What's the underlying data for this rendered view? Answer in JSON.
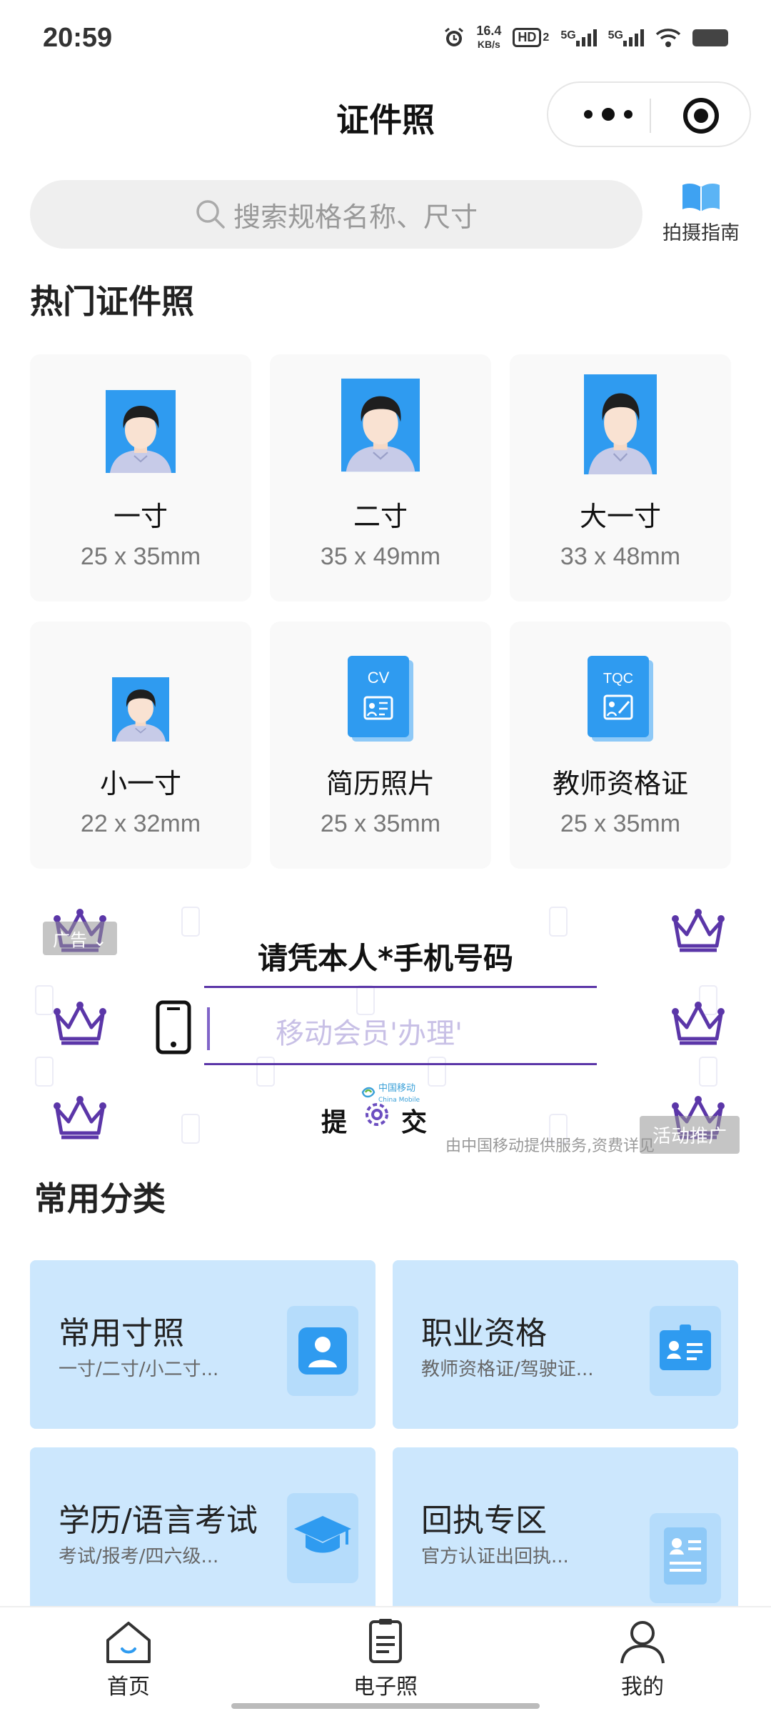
{
  "status_bar": {
    "time": "20:59",
    "speed_value": "16.4",
    "speed_unit": "KB/s",
    "hd_label": "HD",
    "hd_sub": "2",
    "net1": "5G",
    "net2": "5G",
    "icons": [
      "alarm-icon",
      "hd-icon",
      "signal-icon",
      "signal-icon",
      "wifi-icon",
      "battery-icon"
    ]
  },
  "navbar": {
    "title": "证件照"
  },
  "search": {
    "placeholder": "搜索规格名称、尺寸"
  },
  "guide": {
    "label": "拍摄指南"
  },
  "hot": {
    "title": "热门证件照",
    "cards": [
      {
        "name": "一寸",
        "size": "25 x 35mm"
      },
      {
        "name": "二寸",
        "size": "35 x 49mm"
      },
      {
        "name": "大一寸",
        "size": "33 x 48mm"
      },
      {
        "name": "小一寸",
        "size": "22 x 32mm"
      },
      {
        "name": "简历照片",
        "size": "25 x 35mm",
        "icon_text": "CV"
      },
      {
        "name": "教师资格证",
        "size": "25 x 35mm",
        "icon_text": "TQC"
      }
    ]
  },
  "ad": {
    "tag": "广告",
    "headline": "请凭本人*手机号码",
    "input_placeholder": "移动会员'办理'",
    "submit_left": "提",
    "submit_right": "交",
    "brand": "中国移动",
    "brand_en": "China Mobile",
    "note": "由中国移动提供服务,资费详见",
    "promo": "活动推广"
  },
  "categories": {
    "title": "常用分类",
    "items": [
      {
        "title": "常用寸照",
        "desc": "一寸/二寸/小二寸..."
      },
      {
        "title": "职业资格",
        "desc": "教师资格证/驾驶证..."
      },
      {
        "title": "学历/语言考试",
        "desc": "考试/报考/四六级..."
      },
      {
        "title": "回执专区",
        "desc": "官方认证出回执..."
      }
    ]
  },
  "tabbar": {
    "items": [
      {
        "label": "首页",
        "icon": "home-icon",
        "active": true
      },
      {
        "label": "电子照",
        "icon": "document-icon"
      },
      {
        "label": "我的",
        "icon": "user-icon"
      }
    ]
  },
  "colors": {
    "accent": "#2f9bf0",
    "ad_purple": "#5b36a8",
    "category_bg": "#cce7fd"
  }
}
